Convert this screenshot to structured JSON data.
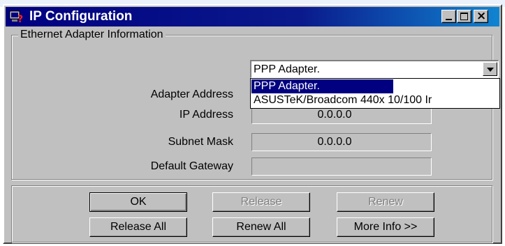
{
  "window": {
    "title": "IP Configuration",
    "controls": [
      "minimize-icon",
      "maximize-icon",
      "close-icon"
    ]
  },
  "group": {
    "legend": "Ethernet  Adapter Information"
  },
  "adapter_select": {
    "selected": "PPP Adapter.",
    "options": [
      "PPP Adapter.",
      "ASUSTeK/Broadcom 440x 10/100 Ir"
    ],
    "highlighted_index": 0
  },
  "fields": {
    "adapter_address_label": "Adapter Address",
    "ip_address_label": "IP Address",
    "ip_address_value": "0.0.0.0",
    "subnet_mask_label": "Subnet Mask",
    "subnet_mask_value": "0.0.0.0",
    "default_gateway_label": "Default Gateway",
    "default_gateway_value": ""
  },
  "buttons": {
    "ok": "OK",
    "release": "Release",
    "renew": "Renew",
    "release_all": "Release All",
    "renew_all": "Renew All",
    "more_info": "More Info >>"
  },
  "colors": {
    "titlebar": "#000080",
    "face": "#c0c0c0",
    "highlight": "#000080"
  }
}
